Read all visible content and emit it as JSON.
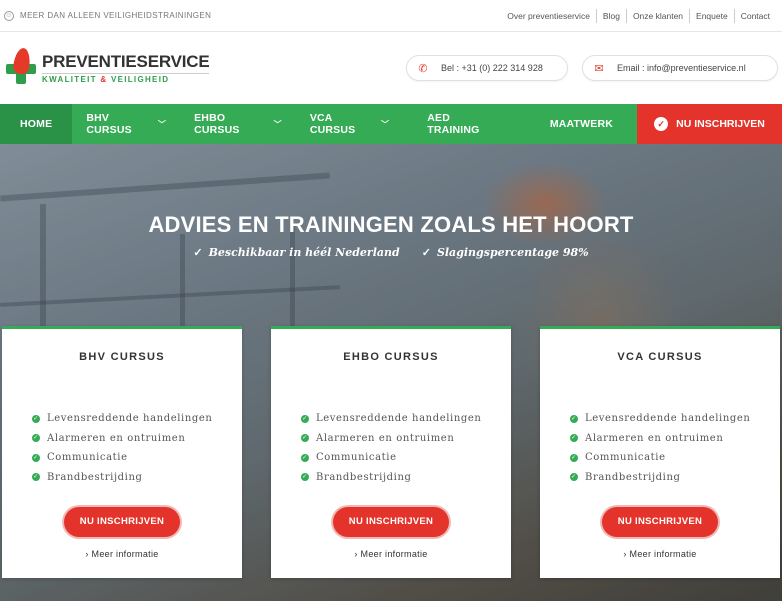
{
  "topbar": {
    "tagline": "MEER DAN ALLEEN VEILIGHEIDSTRAININGEN",
    "tagline_icon": "smiley-icon",
    "links": [
      "Over preventieservice",
      "Blog",
      "Onze klanten",
      "Enquete",
      "Contact"
    ]
  },
  "logo": {
    "name": "PREVENTIESERVICE",
    "tag_part1": "KWALITEIT",
    "tag_amp": "&",
    "tag_part2": "VEILIGHEID"
  },
  "contact": {
    "phone": "Bel : +31 (0) 222 314 928",
    "phone_icon": "phone-icon",
    "email": "Email : info@preventieservice.nl",
    "email_icon": "envelope-icon"
  },
  "nav": {
    "items": [
      {
        "label": "HOME",
        "dropdown": false
      },
      {
        "label": "BHV CURSUS",
        "dropdown": true
      },
      {
        "label": "EHBO CURSUS",
        "dropdown": true
      },
      {
        "label": "VCA CURSUS",
        "dropdown": true
      },
      {
        "label": "AED TRAINING",
        "dropdown": false
      },
      {
        "label": "MAATWERK",
        "dropdown": false
      }
    ],
    "cta": "NU INSCHRIJVEN"
  },
  "hero": {
    "title": "ADVIES EN TRAININGEN ZOALS HET HOORT",
    "usps": [
      "Beschikbaar in héél Nederland",
      "Slagingspercentage 98%"
    ]
  },
  "cards": [
    {
      "title": "BHV CURSUS",
      "items": [
        "Levensreddende handelingen",
        "Alarmeren en ontruimen",
        "Communicatie",
        "Brandbestrijding"
      ],
      "button": "NU INSCHRIJVEN",
      "more": "Meer informatie"
    },
    {
      "title": "EHBO CURSUS",
      "items": [
        "Levensreddende handelingen",
        "Alarmeren en ontruimen",
        "Communicatie",
        "Brandbestrijding"
      ],
      "button": "NU INSCHRIJVEN",
      "more": "Meer informatie"
    },
    {
      "title": "VCA CURSUS",
      "items": [
        "Levensreddende handelingen",
        "Alarmeren en ontruimen",
        "Communicatie",
        "Brandbestrijding"
      ],
      "button": "NU INSCHRIJVEN",
      "more": "Meer informatie"
    }
  ],
  "colors": {
    "green": "#35ab55",
    "green_dark": "#2a9247",
    "red": "#e3332a"
  }
}
